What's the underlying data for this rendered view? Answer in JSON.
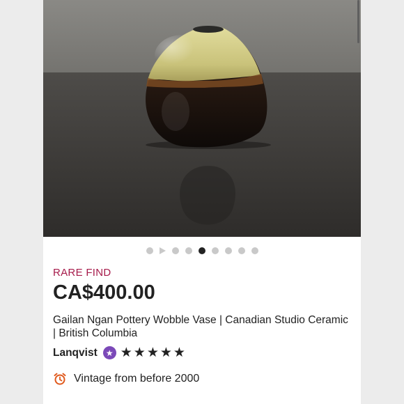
{
  "listing": {
    "badge": "RARE FIND",
    "price": "CA$400.00",
    "title": "Gailan Ngan Pottery Wobble Vase | Canadian Studio Ceramic | British Columbia",
    "shop_name": "Lanqvist",
    "rating_stars": 5,
    "vintage_label": "Vintage from before 2000"
  },
  "carousel": {
    "total_slides": 9,
    "active_index": 4,
    "video_index": 1
  },
  "colors": {
    "badge": "#a61a4a",
    "star_seller": "#7b49b8",
    "clock_icon": "#e0591c",
    "active_dot": "#222222",
    "inactive_dot": "#c9c9c9"
  },
  "icons": {
    "star_seller": "star-seller-badge-icon",
    "rating": "star-icon",
    "vintage": "alarm-clock-icon"
  }
}
